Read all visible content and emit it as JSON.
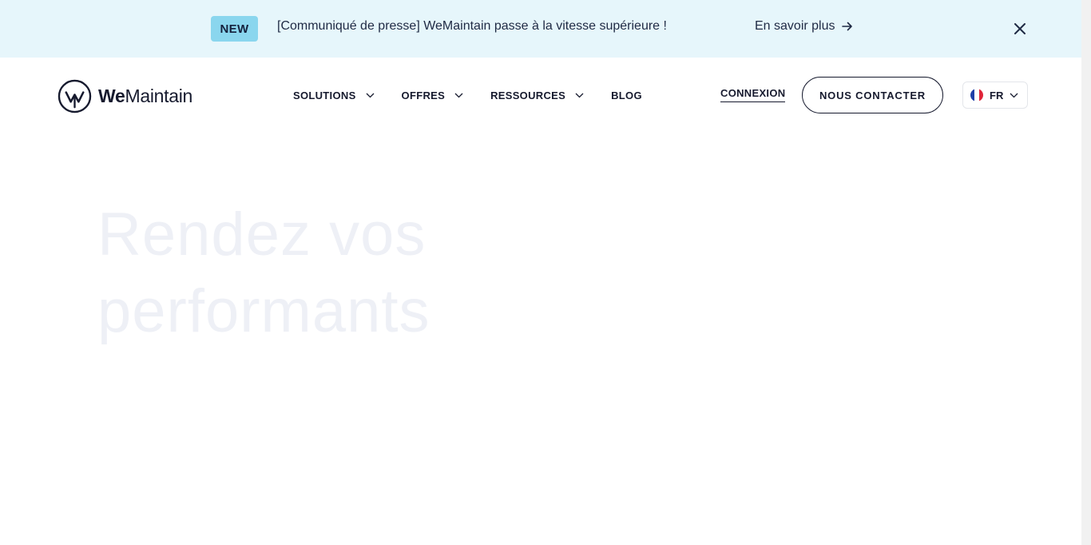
{
  "announcement": {
    "badge": "NEW",
    "text": "[Communiqué de presse] WeMaintain passe à la vitesse supérieure !",
    "link_label": "En savoir plus",
    "link_icon": "arrow-right-icon",
    "close_icon": "close-icon",
    "background_color": "#e6f6fb",
    "badge_color": "#8ad6ee"
  },
  "header": {
    "logo": {
      "brand_bold": "We",
      "brand_regular": "Maintain",
      "mark_icon": "wemaintain-logo-mark"
    },
    "nav": [
      {
        "label": "SOLUTIONS",
        "has_dropdown": true
      },
      {
        "label": "OFFRES",
        "has_dropdown": true
      },
      {
        "label": "RESSOURCES",
        "has_dropdown": true
      },
      {
        "label": "BLOG",
        "has_dropdown": false
      }
    ],
    "login_label": "CONNEXION",
    "contact_label": "NOUS CONTACTER",
    "language": {
      "label": "FR",
      "flag_icon": "france-flag-icon"
    }
  },
  "hero": {
    "title_lines": [
      "Rendez vos",
      "performants"
    ],
    "text_color": "#eef0f6"
  },
  "colors": {
    "text": "#161a2e",
    "accent": "#8ad6ee"
  }
}
